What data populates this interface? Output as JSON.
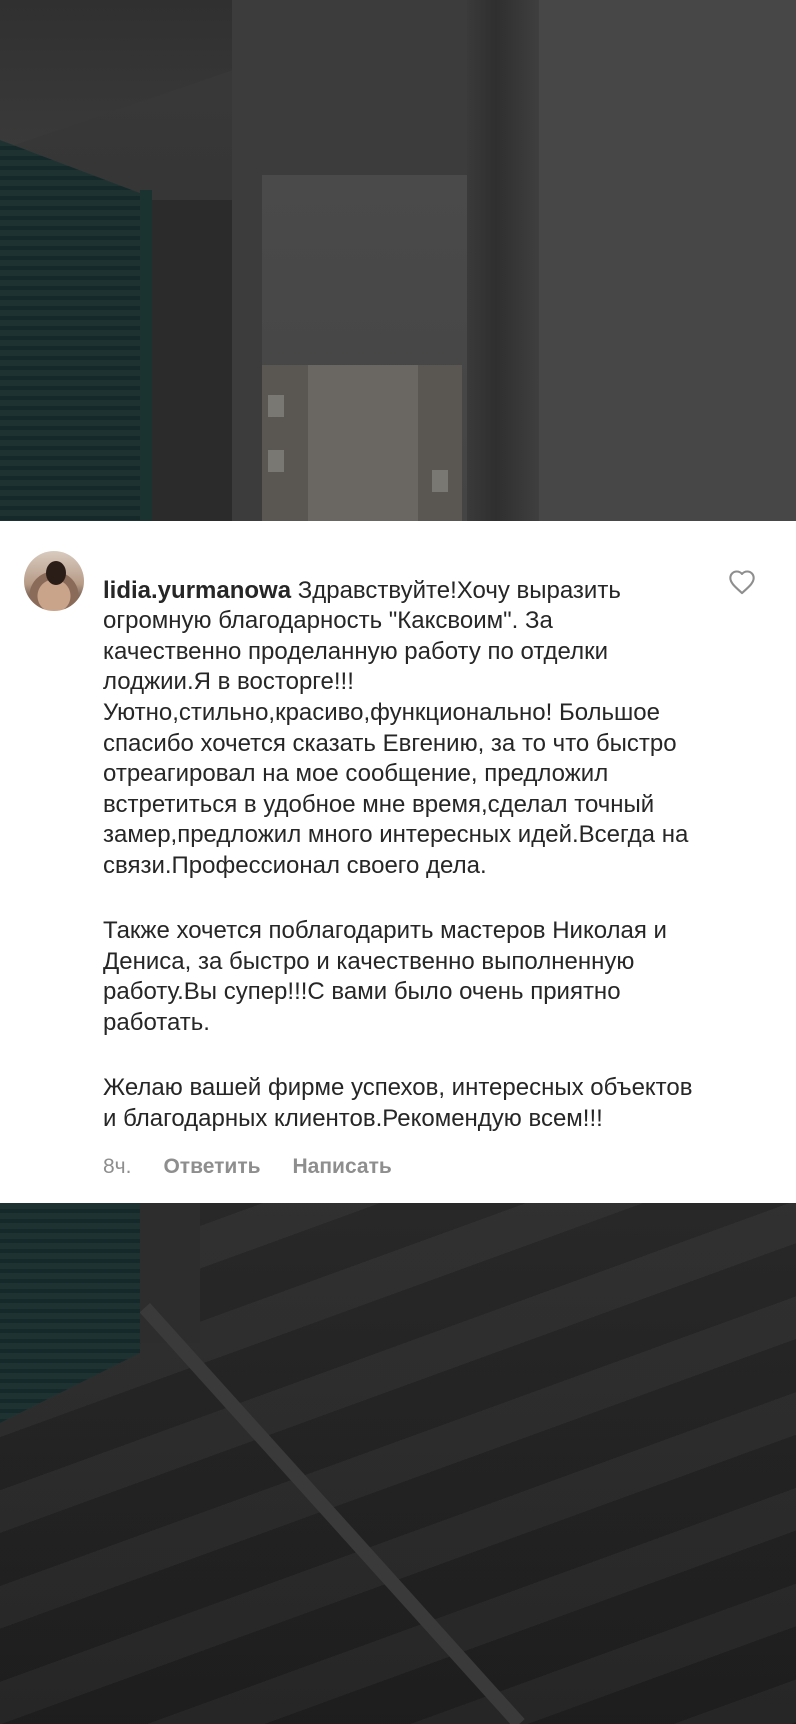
{
  "comment": {
    "username": "lidia.yurmanowa",
    "paragraphs": [
      " Здравствуйте!Хочу выразить огромную благодарность \"Каксвоим\". За качественно проделанную работу по отделки лоджии.Я в восторге!!! Уютно,стильно,красиво,функционально! Большое спасибо хочется сказать Евгению, за то что быстро отреагировал на мое сообщение, предложил встретиться в удобное мне время,сделал точный замер,предложил много интересных идей.Всегда на связи.Профессионал своего дела.",
      "Также хочется поблагодарить мастеров Николая и Дениса, за быстро и качественно выполненную работу.Вы супер!!!С вами было очень  приятно работать.",
      "Желаю  вашей  фирме успехов, интересных объектов и благодарных клиентов.Рекомендую всем!!!"
    ],
    "time": "8ч.",
    "reply_label": "Ответить",
    "message_label": "Написать",
    "liked": false
  },
  "colors": {
    "card_background": "#ffffff",
    "text": "#262626",
    "meta_text": "#8e8e8e"
  },
  "icons": {
    "like": "heart-outline-icon",
    "avatar": "profile-photo"
  }
}
